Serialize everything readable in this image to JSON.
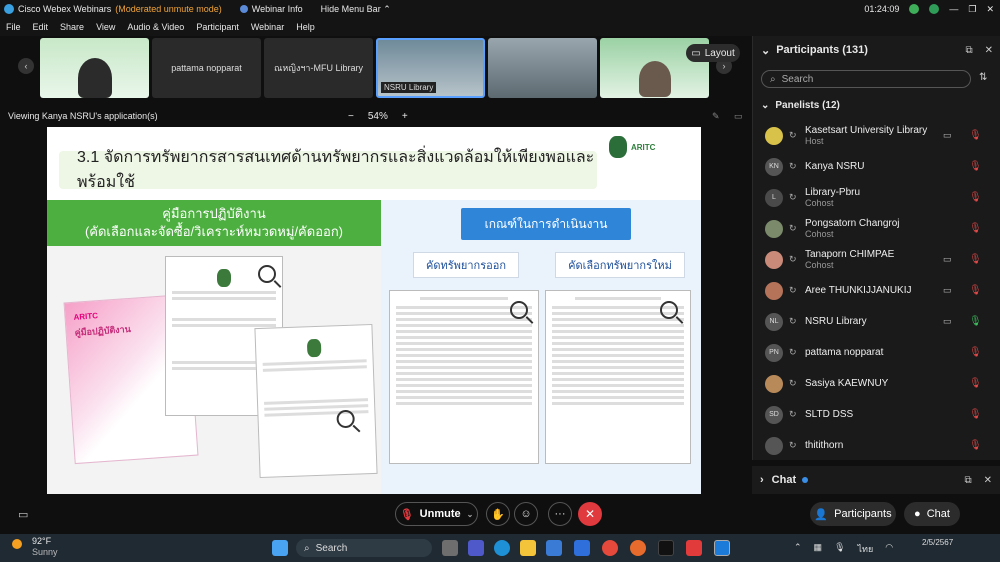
{
  "titlebar": {
    "app": "Cisco Webex Webinars",
    "mode": "(Moderated unmute mode)",
    "webinar_info": "Webinar Info",
    "hide_menu": "Hide Menu Bar",
    "clock": "01:24:09"
  },
  "menu": [
    "File",
    "Edit",
    "Share",
    "View",
    "Audio & Video",
    "Participant",
    "Webinar",
    "Help"
  ],
  "thumbs": [
    {
      "label": ""
    },
    {
      "label": "pattama nopparat"
    },
    {
      "label": "ณหญิงฯา-MFU Library"
    },
    {
      "label": "NSRU Library"
    },
    {
      "label": ""
    },
    {
      "label": ""
    }
  ],
  "layout_label": "Layout",
  "viewing": "Viewing Kanya NSRU's application(s)",
  "zoom": "54%",
  "slide": {
    "title": "3.1 จัดการทรัพยากรสารสนเทศด้านทรัพยากรและสิ่งแวดล้อมให้เพียงพอและพร้อมใช้",
    "logo_text": "ARITC",
    "manual_line1": "คู่มือการปฏิบัติงาน",
    "manual_line2": "(คัดเลือกและจัดซื้อ/วิเคราะห์หมวดหมู่/คัดออก)",
    "criteria": "เกณฑ์ในการดำเนินงาน",
    "btn_out": "คัดทรัพยากรออก",
    "btn_new": "คัดเลือกทรัพยากรใหม่",
    "book_brand": "ARITC",
    "book_title": "คู่มือปฏิบัติงาน"
  },
  "controls": {
    "unmute": "Unmute"
  },
  "participants": {
    "title": "Participants (131)",
    "search_placeholder": "Search",
    "panelists": "Panelists (12)",
    "list": [
      {
        "initials": "",
        "name": "Kasetsart University Library",
        "role": "Host",
        "cam": true,
        "mic": "muted"
      },
      {
        "initials": "KN",
        "name": "Kanya NSRU",
        "role": "",
        "cam": false,
        "mic": "muted"
      },
      {
        "initials": "L",
        "name": "Library-Pbru",
        "role": "Cohost",
        "cam": false,
        "mic": "muted"
      },
      {
        "initials": "",
        "name": "Pongsatorn Changroj",
        "role": "Cohost",
        "cam": false,
        "mic": "muted"
      },
      {
        "initials": "",
        "name": "Tanaporn CHIMPAE",
        "role": "Cohost",
        "cam": true,
        "mic": "muted"
      },
      {
        "initials": "",
        "name": "Aree THUNKIJJANUKIJ",
        "role": "",
        "cam": true,
        "mic": "muted"
      },
      {
        "initials": "NL",
        "name": "NSRU Library",
        "role": "",
        "cam": true,
        "mic": "on"
      },
      {
        "initials": "PN",
        "name": "pattama nopparat",
        "role": "",
        "cam": false,
        "mic": "muted"
      },
      {
        "initials": "",
        "name": "Sasiya KAEWNUY",
        "role": "",
        "cam": false,
        "mic": "muted"
      },
      {
        "initials": "SD",
        "name": "SLTD DSS",
        "role": "",
        "cam": false,
        "mic": "muted"
      },
      {
        "initials": "",
        "name": "thitithorn",
        "role": "",
        "cam": false,
        "mic": "muted"
      }
    ]
  },
  "chat": {
    "label": "Chat"
  },
  "bottom_buttons": {
    "participants": "Participants",
    "chat": "Chat"
  },
  "taskbar": {
    "temp": "92°F",
    "weather": "Sunny",
    "search": "Search",
    "lang": "ไทย",
    "date": "2/5/2567"
  }
}
